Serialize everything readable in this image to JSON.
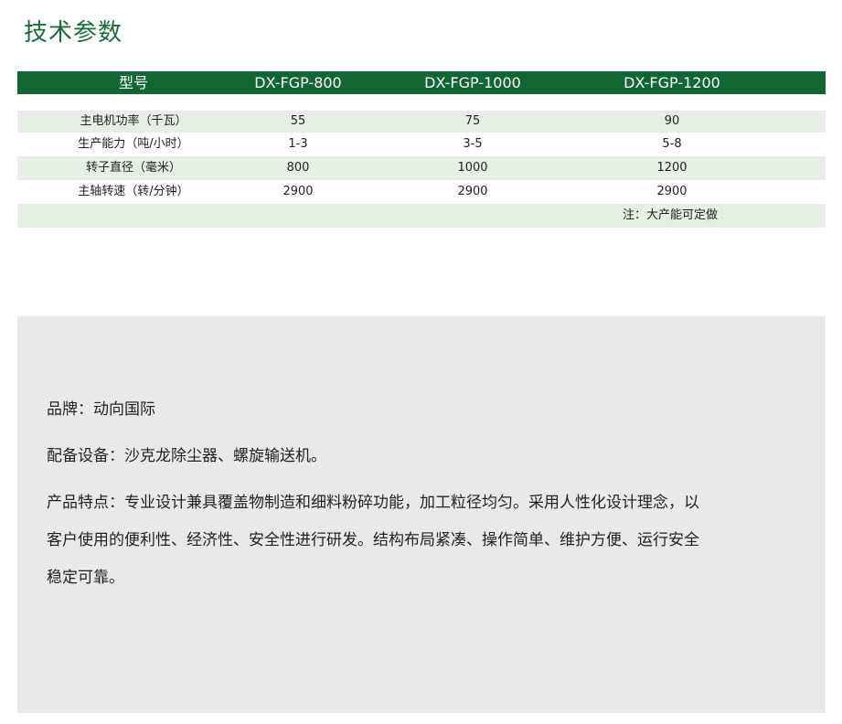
{
  "title": "技术参数",
  "table": {
    "header": [
      "型号",
      "DX-FGP-800",
      "DX-FGP-1000",
      "DX-FGP-1200"
    ],
    "rows": [
      [
        "主电机功率（千瓦）",
        "55",
        "75",
        "90"
      ],
      [
        "生产能力（吨/小时）",
        "1-3",
        "3-5",
        "5-8"
      ],
      [
        "转子直径（毫米）",
        "800",
        "1000",
        "1200"
      ],
      [
        "主轴转速（转/分钟）",
        "2900",
        "2900",
        "2900"
      ]
    ],
    "note": "注：大产能可定做"
  },
  "description": {
    "brand": "品牌：动向国际",
    "equipment": "配备设备：沙克龙除尘器、螺旋输送机。",
    "features_line1": "产品特点：专业设计兼具覆盖物制造和细料粉碎功能，加工粒径均匀。采用人性化设计理念，以",
    "features_line2": "客户使用的便利性、经济性、安全性进行研发。结构布局紧凑、操作简单、维护方便、运行安全",
    "features_line3": "稳定可靠。"
  },
  "colors": {
    "header_bg": "#116734",
    "title_color": "#1d6b3c",
    "row_shade": "#e6efe3",
    "desc_bg": "#ebe9e7"
  }
}
